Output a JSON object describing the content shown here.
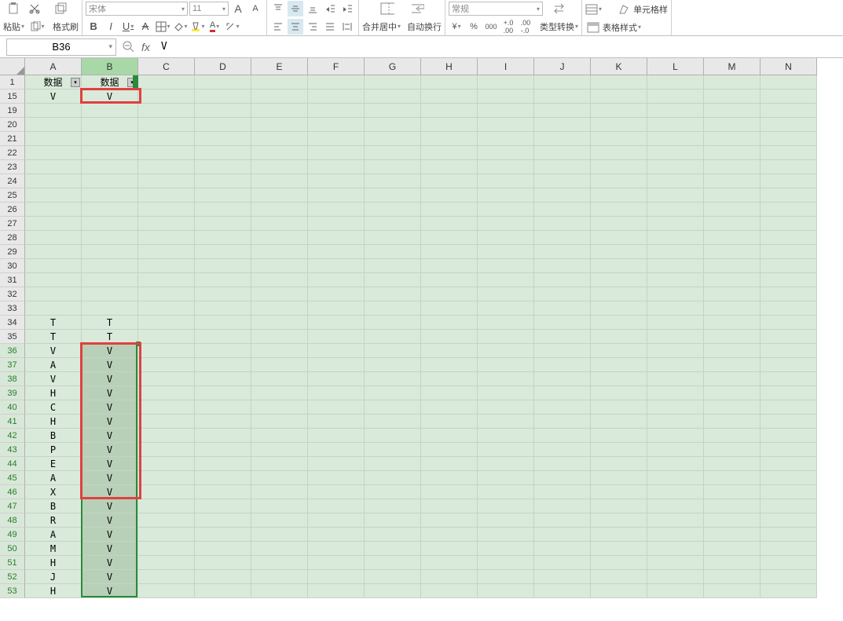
{
  "toolbar": {
    "paste_label": "粘贴",
    "format_painter_label": "格式刷",
    "font_name": "宋体",
    "font_size": "11",
    "merge_center_label": "合并居中",
    "wrap_text_label": "自动换行",
    "number_format": "常规",
    "type_convert_label": "类型转换",
    "table_style_label": "表格样式",
    "cell_style_label": "单元格样"
  },
  "formula_bar": {
    "name_box": "B36",
    "formula_value": "V"
  },
  "columns": [
    "A",
    "B",
    "C",
    "D",
    "E",
    "F",
    "G",
    "H",
    "I",
    "J",
    "K",
    "L",
    "M",
    "N"
  ],
  "active_column_index": 1,
  "visible_rows": [
    1,
    15,
    19,
    20,
    21,
    22,
    23,
    24,
    25,
    26,
    27,
    28,
    29,
    30,
    31,
    32,
    33,
    34,
    35,
    36,
    37,
    38,
    39,
    40,
    41,
    42,
    43,
    44,
    45,
    46,
    47,
    48,
    49,
    50,
    51,
    52,
    53
  ],
  "selected_row_start": 36,
  "selected_row_end": 53,
  "headers": {
    "A1": "数据",
    "B1": "数据"
  },
  "data": {
    "15": {
      "A": "V",
      "B": "V"
    },
    "34": {
      "A": "T",
      "B": "T"
    },
    "35": {
      "A": "T",
      "B": "T"
    },
    "36": {
      "A": "V",
      "B": "V"
    },
    "37": {
      "A": "A",
      "B": "V"
    },
    "38": {
      "A": "V",
      "B": "V"
    },
    "39": {
      "A": "H",
      "B": "V"
    },
    "40": {
      "A": "C",
      "B": "V"
    },
    "41": {
      "A": "H",
      "B": "V"
    },
    "42": {
      "A": "B",
      "B": "V"
    },
    "43": {
      "A": "P",
      "B": "V"
    },
    "44": {
      "A": "E",
      "B": "V"
    },
    "45": {
      "A": "A",
      "B": "V"
    },
    "46": {
      "A": "X",
      "B": "V"
    },
    "47": {
      "A": "B",
      "B": "V"
    },
    "48": {
      "A": "R",
      "B": "V"
    },
    "49": {
      "A": "A",
      "B": "V"
    },
    "50": {
      "A": "M",
      "B": "V"
    },
    "51": {
      "A": "H",
      "B": "V"
    },
    "52": {
      "A": "J",
      "B": "V"
    },
    "53": {
      "A": "H",
      "B": "V"
    }
  },
  "red_highlights": [
    {
      "top_row": 15,
      "col": "B",
      "height_rows": 1
    },
    {
      "top_row": 36,
      "col": "B",
      "height_rows": 11
    }
  ]
}
